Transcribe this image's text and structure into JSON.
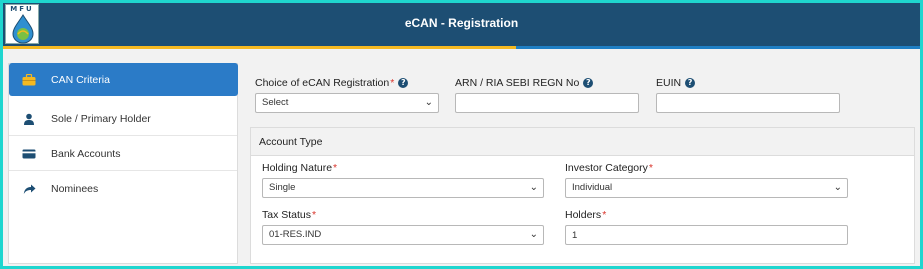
{
  "header": {
    "logo_text": "MFU",
    "title": "eCAN - Registration"
  },
  "colors": {
    "header_bg": "#1d4e73",
    "accent_yellow": "#f5b921",
    "accent_blue": "#1f7fc4",
    "active_item": "#2b7bc7",
    "required": "#d9342b"
  },
  "sidebar": {
    "items": [
      {
        "label": "CAN Criteria",
        "icon": "briefcase-icon",
        "active": true
      },
      {
        "label": "Sole / Primary Holder",
        "icon": "user-icon",
        "active": false
      },
      {
        "label": "Bank Accounts",
        "icon": "card-icon",
        "active": false
      },
      {
        "label": "Nominees",
        "icon": "share-arrow-icon",
        "active": false
      }
    ]
  },
  "form": {
    "registration": {
      "label": "Choice of eCAN Registration",
      "required": "*",
      "value": "Select"
    },
    "arn": {
      "label": "ARN / RIA SEBI REGN No",
      "value": ""
    },
    "euin": {
      "label": "EUIN",
      "value": ""
    }
  },
  "account_type": {
    "title": "Account Type",
    "holding_nature": {
      "label": "Holding Nature",
      "required": "*",
      "value": "Single"
    },
    "investor_category": {
      "label": "Investor Category",
      "required": "*",
      "value": "Individual"
    },
    "tax_status": {
      "label": "Tax Status",
      "required": "*",
      "value": "01-RES.IND"
    },
    "holders": {
      "label": "Holders",
      "required": "*",
      "value": "1"
    }
  }
}
